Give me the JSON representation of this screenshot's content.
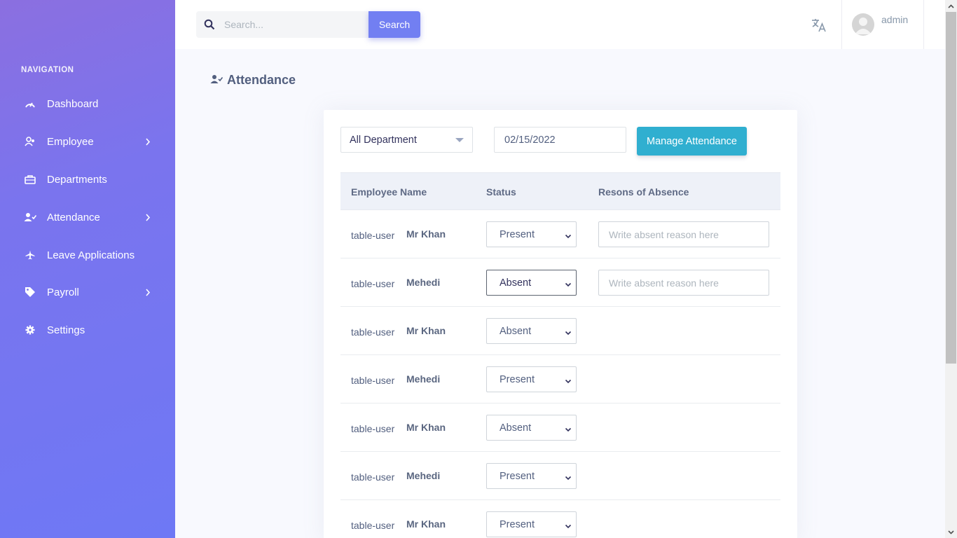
{
  "sidebar": {
    "heading": "NAVIGATION",
    "items": [
      {
        "label": "Dashboard",
        "icon": "gauge-icon",
        "chevron": false
      },
      {
        "label": "Employee",
        "icon": "users-icon",
        "chevron": true
      },
      {
        "label": "Departments",
        "icon": "briefcase-icon",
        "chevron": false
      },
      {
        "label": "Attendance",
        "icon": "user-check-icon",
        "chevron": true
      },
      {
        "label": "Leave Applications",
        "icon": "plane-icon",
        "chevron": false
      },
      {
        "label": "Payroll",
        "icon": "tag-icon",
        "chevron": true
      },
      {
        "label": "Settings",
        "icon": "gear-icon",
        "chevron": false
      }
    ]
  },
  "topbar": {
    "search_placeholder": "Search...",
    "search_button": "Search",
    "username": "admin"
  },
  "page": {
    "title": "Attendance"
  },
  "filters": {
    "department": "All Department",
    "date": "02/15/2022",
    "manage_button": "Manage Attendance"
  },
  "table": {
    "headers": [
      "Employee Name",
      "Status",
      "Resons of Absence"
    ],
    "reason_placeholder": "Write absent reason here",
    "rows": [
      {
        "tag": "table-user",
        "name": "Mr Khan",
        "status": "Present",
        "reason_field": true
      },
      {
        "tag": "table-user",
        "name": "Mehedi",
        "status": "Absent",
        "reason_field": true
      },
      {
        "tag": "table-user",
        "name": "Mr Khan",
        "status": "Absent",
        "reason_field": false
      },
      {
        "tag": "table-user",
        "name": "Mehedi",
        "status": "Present",
        "reason_field": false
      },
      {
        "tag": "table-user",
        "name": "Mr Khan",
        "status": "Absent",
        "reason_field": false
      },
      {
        "tag": "table-user",
        "name": "Mehedi",
        "status": "Present",
        "reason_field": false
      },
      {
        "tag": "table-user",
        "name": "Mr Khan",
        "status": "Present",
        "reason_field": false
      }
    ]
  },
  "colors": {
    "sidebar_gradient_start": "#8b6fe0",
    "sidebar_gradient_end": "#6e78f5",
    "search_button": "#727ff2",
    "manage_button": "#30afd0"
  }
}
